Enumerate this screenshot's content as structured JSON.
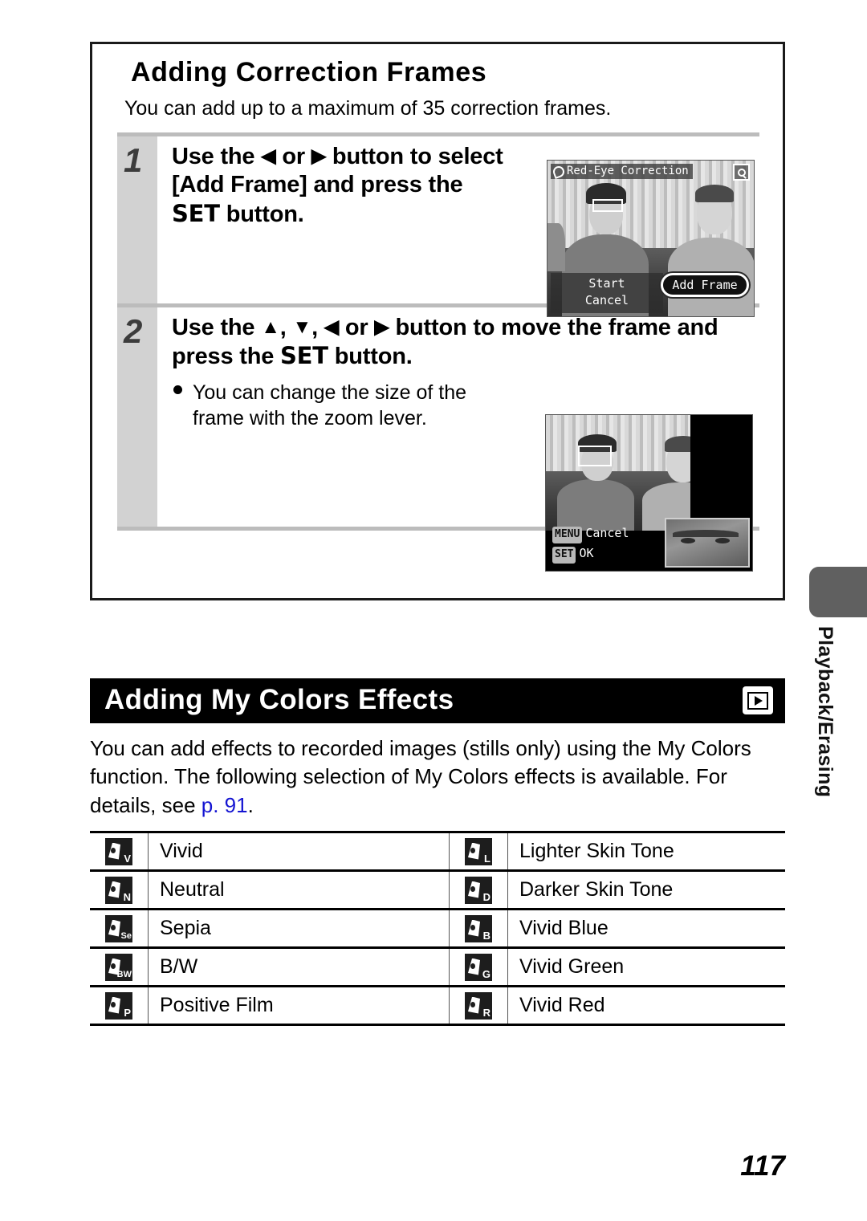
{
  "section_box": {
    "title": "Adding Correction Frames",
    "subtitle": "You can add up to a maximum of 35 correction frames.",
    "steps": [
      {
        "number": "1",
        "heading_part1": "Use the ",
        "arrow_left": "◀",
        "heading_or": " or ",
        "arrow_right": "▶",
        "heading_part2": " button to select [Add Frame] and press the ",
        "set_label": "SET",
        "heading_part3": " button."
      },
      {
        "number": "2",
        "heading_part1": "Use the ",
        "arrow_up": "▲",
        "sep1": ", ",
        "arrow_down": "▼",
        "sep2": ", ",
        "arrow_left": "◀",
        "heading_or": " or ",
        "arrow_right": "▶",
        "heading_part2": " button to move the frame and press the ",
        "set_label": "SET",
        "heading_part3": " button.",
        "bullet_line1": "You can change the size of the",
        "bullet_line2": "frame with the zoom lever."
      }
    ]
  },
  "lcd_screen_1": {
    "title": "Red-Eye Correction",
    "title_icon": "red-eye-icon",
    "corner_icon": "magnifier-icon",
    "menu_items": [
      "Start",
      "Cancel"
    ],
    "highlighted_button": "Add Frame"
  },
  "lcd_screen_2": {
    "hint_menu_key": "MENU",
    "hint_menu_action": "Cancel",
    "hint_set_key": "SET",
    "hint_set_action": "OK"
  },
  "my_colors": {
    "heading": "Adding My Colors Effects",
    "heading_icon": "playback-mode-icon",
    "intro_part1": "You can add effects to recorded images (stills only) using the My Colors function. The following selection of My Colors effects is available. For details, see ",
    "intro_link": "p. 91",
    "intro_part2": "."
  },
  "effects_table": {
    "rows": [
      {
        "left_icon": "V",
        "left_label": "Vivid",
        "right_icon": "L",
        "right_label": "Lighter Skin Tone"
      },
      {
        "left_icon": "N",
        "left_label": "Neutral",
        "right_icon": "D",
        "right_label": "Darker Skin Tone"
      },
      {
        "left_icon": "Se",
        "left_label": "Sepia",
        "right_icon": "B",
        "right_label": "Vivid Blue"
      },
      {
        "left_icon": "BW",
        "left_label": "B/W",
        "right_icon": "G",
        "right_label": "Vivid Green"
      },
      {
        "left_icon": "P",
        "left_label": "Positive Film",
        "right_icon": "R",
        "right_label": "Vivid Red"
      }
    ]
  },
  "side_tab": {
    "label": "Playback/Erasing"
  },
  "page_number": "117",
  "colors": {
    "link": "#1414d2",
    "bar_background": "#000000",
    "tab_gray": "#606060",
    "gutter_gray": "#d2d2d2"
  }
}
